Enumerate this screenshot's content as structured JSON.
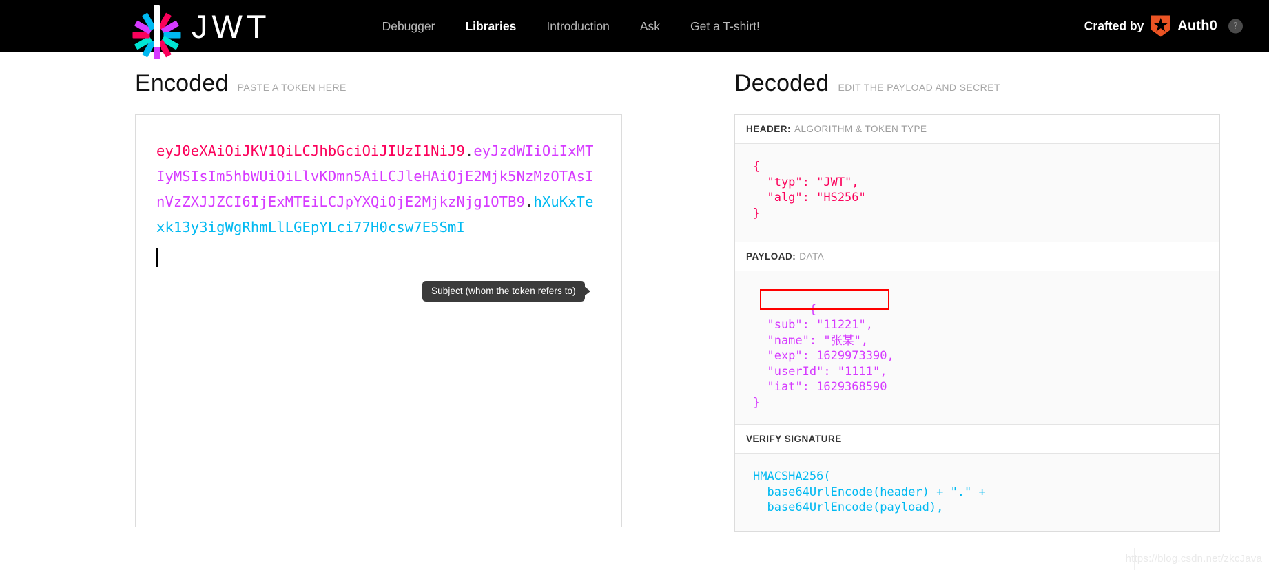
{
  "navbar": {
    "logo_name": "jwt-logo",
    "wordmark": "JWT",
    "links": [
      {
        "label": "Debugger",
        "active": false
      },
      {
        "label": "Libraries",
        "active": true
      },
      {
        "label": "Introduction",
        "active": false
      },
      {
        "label": "Ask",
        "active": false
      },
      {
        "label": "Get a T-shirt!",
        "active": false
      }
    ],
    "crafted_by": "Crafted by",
    "auth0_label": "Auth0",
    "help_icon": "question-mark-icon",
    "help_glyph": "?",
    "background": "#000000"
  },
  "encoded": {
    "title": "Encoded",
    "subtitle": "PASTE A TOKEN HERE",
    "token": {
      "header": "eyJ0eXAiOiJKV1QiLCJhbGciOiJIUzI1NiJ9",
      "dot1": ".",
      "payload": "eyJzdWIiOiIxMTIyMSIsIm5hbWUiOiLlvKDmn5AiLCJleHAiOjE2Mjk5NzMzOTAsInVzZXJJZCI6IjExMTEiLCJpYXQiOjE2MjkzNjg1OTB9",
      "dot2": ".",
      "signature": "hXuKxTexk13y3igWgRhmLlLGEpYLci77H0csw7E5SmI"
    },
    "colors": {
      "header": "#fb015b",
      "payload": "#d63aff",
      "signature": "#00b9f1"
    }
  },
  "decoded": {
    "title": "Decoded",
    "subtitle": "EDIT THE PAYLOAD AND SECRET",
    "sections": [
      {
        "key": "HEADER:",
        "value": "ALGORITHM & TOKEN TYPE"
      },
      {
        "key": "PAYLOAD:",
        "value": "DATA"
      },
      {
        "key": "VERIFY SIGNATURE",
        "value": ""
      }
    ],
    "header_json": "{\n  \"typ\": \"JWT\",\n  \"alg\": \"HS256\"\n}",
    "payload_json": "{\n  \"sub\": \"11221\",\n  \"name\": \"张某\",\n  \"exp\": 1629973390,\n  \"userId\": \"1111\",\n  \"iat\": 1629368590\n}",
    "signature_code": "HMACSHA256(\n  base64UrlEncode(header) + \".\" +\n  base64UrlEncode(payload),"
  },
  "tooltip": {
    "text": "Subject (whom the token refers to)"
  },
  "highlight": {
    "color": "#ff0000",
    "target": "sub-claim"
  },
  "watermark": {
    "text": "https://blog.csdn.net/zkcJava"
  }
}
